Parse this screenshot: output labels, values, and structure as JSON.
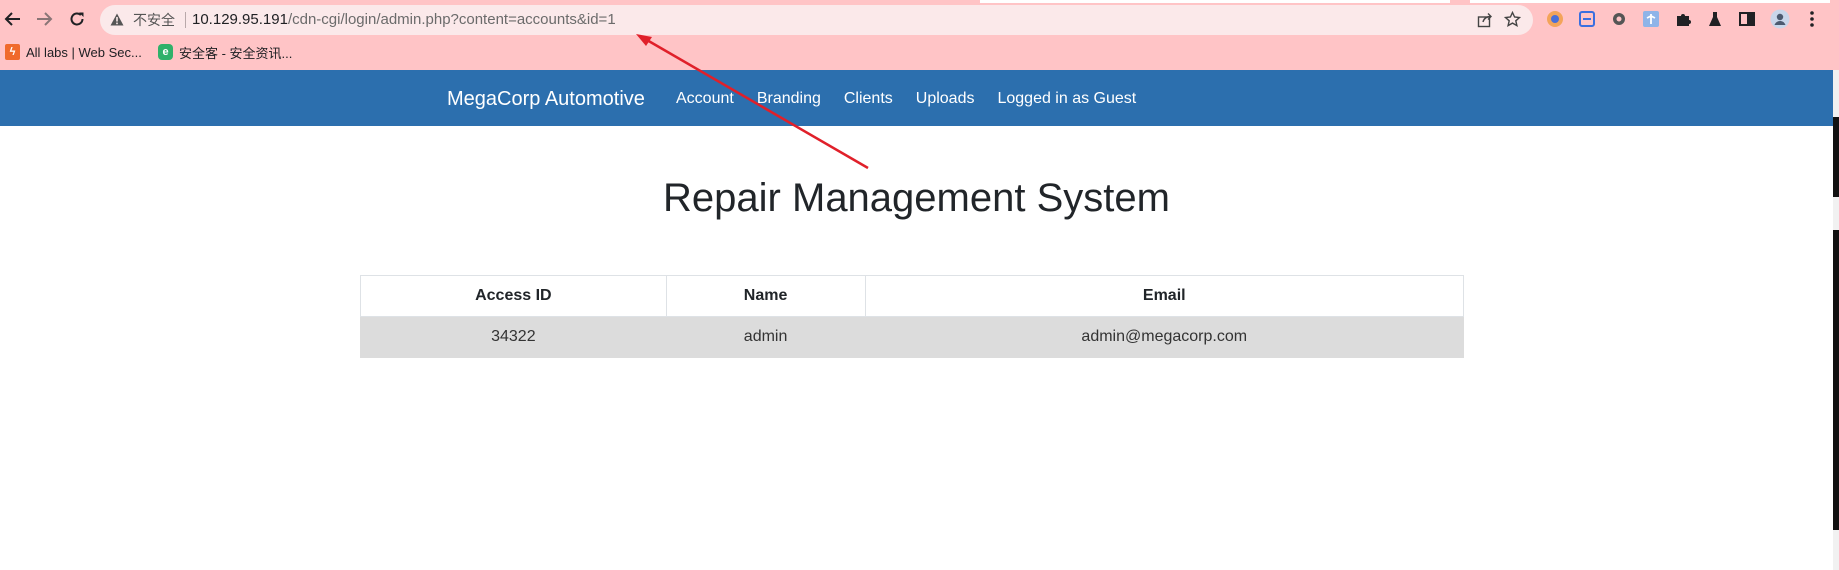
{
  "browser": {
    "omnibox": {
      "security_label": "不安全",
      "url_host": "10.129.95.191",
      "url_path": "/cdn-cgi/login/admin.php?content=accounts&id=1"
    },
    "bookmarks": [
      {
        "label": "All labs | Web Sec...",
        "icon_color": "#f06a2c"
      },
      {
        "label": "安全客 - 安全资讯...",
        "icon_color": "#2fb16a"
      }
    ],
    "colors": {
      "chrome_bg": "#ffc4c6",
      "omnibox_bg": "#fbe9ea"
    }
  },
  "site": {
    "brand": "MegaCorp Automotive",
    "nav": [
      "Account",
      "Branding",
      "Clients",
      "Uploads",
      "Logged in as Guest"
    ],
    "title": "Repair Management System",
    "table": {
      "headers": [
        "Access ID",
        "Name",
        "Email"
      ],
      "rows": [
        [
          "34322",
          "admin",
          "admin@megacorp.com"
        ]
      ]
    },
    "colors": {
      "navbar_bg": "#2c6fae",
      "row_bg": "#dcdcdc"
    }
  },
  "annotation": {
    "color": "#e0202a"
  }
}
